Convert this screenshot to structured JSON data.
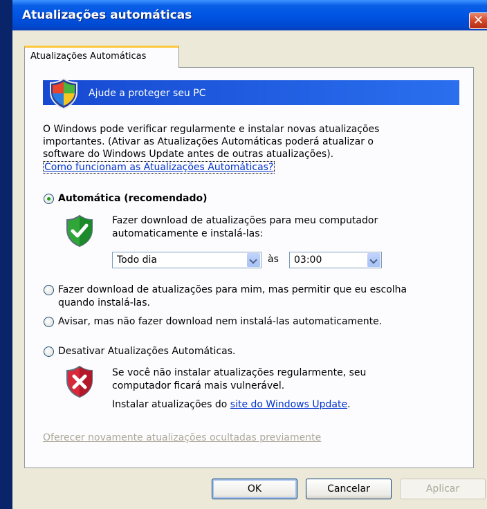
{
  "window": {
    "title": "Atualizações automáticas"
  },
  "tab": {
    "label": "Atualizações Automáticas"
  },
  "banner": {
    "text": "Ajude a proteger seu PC"
  },
  "intro": {
    "line1": "O Windows pode verificar regularmente e instalar novas atualizações",
    "line2": "importantes. (Ativar as Atualizações Automáticas poderá atualizar o",
    "line3": "software do Windows Update antes de outras atualizações).",
    "link": "Como funcionam as Atualizações Automáticas?"
  },
  "options": {
    "automatic": {
      "label": "Automática (recomendado)",
      "checked": true,
      "desc1": "Fazer download de atualizações para meu computador",
      "desc2": "automaticamente e instalá-las:",
      "frequency": "Todo dia",
      "at_label": "às",
      "time": "03:00"
    },
    "download_only": {
      "line1": "Fazer download de atualizações para mim, mas permitir que eu escolha",
      "line2": "quando instalá-las.",
      "checked": false
    },
    "notify": {
      "label": "Avisar, mas não fazer download nem instalá-las automaticamente.",
      "checked": false
    },
    "disable": {
      "label": "Desativar Atualizações Automáticas.",
      "checked": false,
      "warn1": "Se você não instalar atualizações regularmente, seu",
      "warn2": "computador ficará mais vulnerável.",
      "install_prefix": "Instalar atualizações do ",
      "install_link": "site do Windows Update",
      "install_suffix": "."
    }
  },
  "offer_link": "Oferecer novamente atualizações ocultadas previamente",
  "buttons": {
    "ok": "OK",
    "cancel": "Cancelar",
    "apply": "Aplicar"
  },
  "colors": {
    "titlebar": "#0054e3",
    "banner": "#1c5be0",
    "link": "#0033cc",
    "dialog_bg": "#ece9d8"
  }
}
